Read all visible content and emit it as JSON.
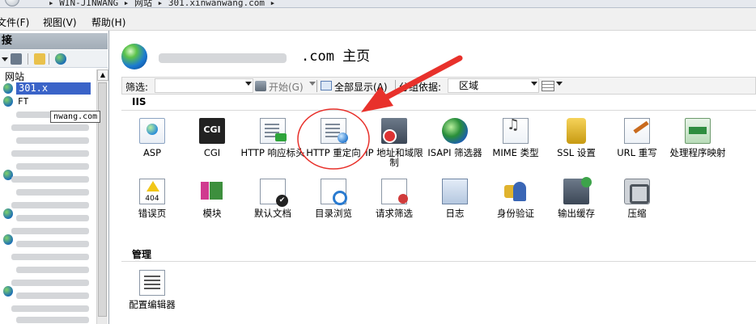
{
  "address": {
    "crumbs": "▸ WIN-JINWANG ▸ 网站 ▸ 301.xinwanwang.com ▸"
  },
  "menu": {
    "file": "文件(F)",
    "view": "视图(V)",
    "help": "帮助(H)"
  },
  "connections": {
    "title": "接",
    "tree_label": "网站",
    "selected_site": "301.x",
    "ftp_site": "FT",
    "tooltip": "nwang.com"
  },
  "header": {
    "title": ".com 主页"
  },
  "filterbar": {
    "filter_label": "筛选:",
    "go_label": "开始(G)",
    "show_all_label": "全部显示(A)",
    "group_label": "分组依据:",
    "group_value": "区域"
  },
  "sections": {
    "iis": "IIS",
    "management": "管理"
  },
  "features": {
    "asp": "ASP",
    "cgi": "CGI",
    "http_headers": "HTTP 响应标头",
    "http_redirect": "HTTP 重定向",
    "ip_restrictions": "IP 地址和域限制",
    "isapi_filters": "ISAPI 筛选器",
    "mime": "MIME 类型",
    "ssl": "SSL 设置",
    "url_rewrite": "URL 重写",
    "handlers": "处理程序映射",
    "error_pages": "错误页",
    "modules": "模块",
    "default_doc": "默认文档",
    "dir_browse": "目录浏览",
    "request_filter": "请求筛选",
    "logging": "日志",
    "auth": "身份验证",
    "output_cache": "输出缓存",
    "compression": "压缩",
    "config_editor": "配置编辑器",
    "error_404": "404"
  },
  "colors": {
    "annotation_red": "#e8312b",
    "selection_blue": "#3a63c8"
  },
  "icons": {
    "asp": "asp-icon",
    "cgi": "cgi-icon",
    "redirect": "http-redirect-icon"
  }
}
